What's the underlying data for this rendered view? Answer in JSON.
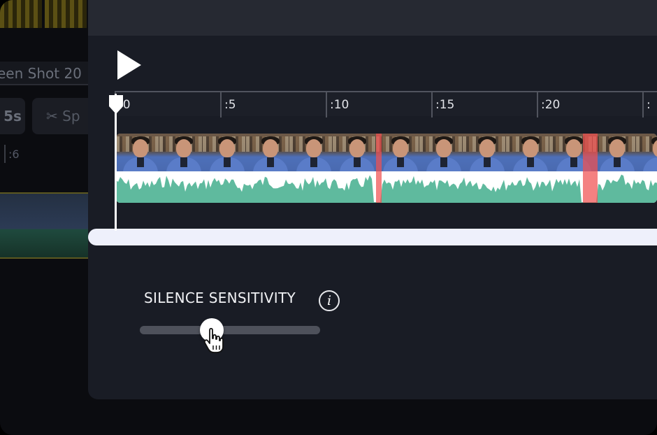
{
  "background_app": {
    "file_title": "een Shot 20",
    "duration_chip": "5s",
    "split_label": "Sp",
    "ruler_label": ":6"
  },
  "modal": {
    "play_icon": "play-icon",
    "timeline": {
      "ruler_labels": [
        ":0",
        ":5",
        ":10",
        ":15",
        ":20",
        ":"
      ],
      "playhead_position_seconds": 0
    },
    "silence_sensitivity": {
      "label": "SILENCE SENSITIVITY",
      "info_icon_glyph": "i",
      "slider_value_fraction": 0.4
    }
  },
  "colors": {
    "waveform": "#5fba9e",
    "silence_marker": "#f05050",
    "modal_bg": "#191c25",
    "scroll_bar": "#eef0fb"
  }
}
